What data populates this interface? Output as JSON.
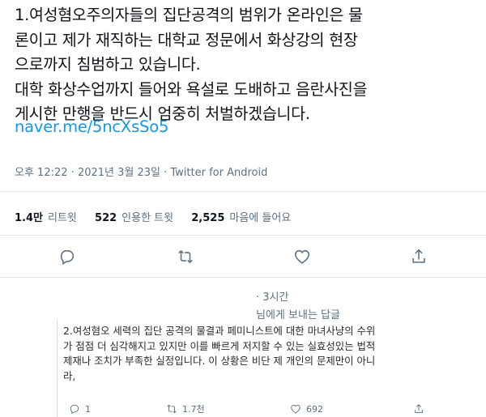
{
  "tweet": {
    "lines": [
      "1.여성혐오주의자들의 집단공격의 범위가 온라인은 물",
      "론이고 제가 재직하는 대학교 정문에서 화상강의 현장",
      "으로까지 침범하고 있습니다.",
      "대학 화상수업까지 들어와 욕설로 도배하고 음란사진을",
      "게시한 만행을 반드시 엄중히 처벌하겠습니다."
    ],
    "link": "naver.me/5ncXsSo5",
    "time": "오후 12:22",
    "date": "2021년 3월 23일",
    "source": "Twitter for Android",
    "separator": " · "
  },
  "stats": {
    "retweets_count": "1.4만",
    "retweets_label": "리트윗",
    "quotes_count": "522",
    "quotes_label": "인용한 트윗",
    "likes_count": "2,525",
    "likes_label": "마음에 들어요"
  },
  "icons": {
    "reply": "reply-icon",
    "retweet": "retweet-icon",
    "like": "heart-icon",
    "share": "share-icon"
  },
  "reply": {
    "time": "· 3시간",
    "reply_to": "님에게 보내는 답글",
    "lines": [
      "2.여성혐오 세력의 집단 공격의 물결과 페미니스트에 대한 마녀사냥의 수위",
      "가 점점 더 심각해지고 있지만 이를 빠르게 저지할 수 있는 실효성있는 법적",
      "제재나 조치가 부족한 실정입니다. 이 상황은 비단 제 개인의 문제만이 아니",
      "라,"
    ],
    "reply_count": "1",
    "retweet_count": "1.7천",
    "like_count": "692"
  },
  "colors": {
    "link": "#1b95e0",
    "secondary": "#5b7083",
    "divider": "#e1e8ed"
  }
}
